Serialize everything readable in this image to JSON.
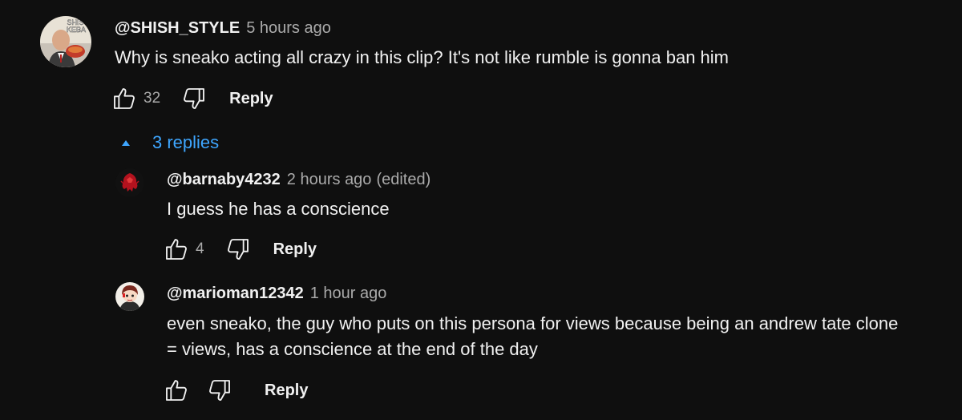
{
  "comment": {
    "author": "@SHISH_STYLE",
    "time": "5 hours ago",
    "text": "Why is sneako acting all crazy in this clip? It's not like rumble is gonna ban him",
    "likes": "32",
    "reply_label": "Reply",
    "avatar_text": [
      "SHIS",
      "KEBA"
    ]
  },
  "replies_toggle": {
    "label": "3 replies"
  },
  "replies": [
    {
      "author": "@barnaby4232",
      "time": "2 hours ago",
      "edited": "(edited)",
      "text": "I guess he has a conscience",
      "likes": "4",
      "reply_label": "Reply"
    },
    {
      "author": "@marioman12342",
      "time": "1 hour ago",
      "text_lines": [
        "even sneako, the guy who puts on this persona for views because being an andrew tate clone",
        "= views, has a conscience at the end of the day"
      ],
      "reply_label": "Reply"
    }
  ],
  "colors": {
    "background": "#0f0f0f",
    "text": "#f1f1f1",
    "secondary": "#aaaaaa",
    "link": "#3ea6ff"
  }
}
